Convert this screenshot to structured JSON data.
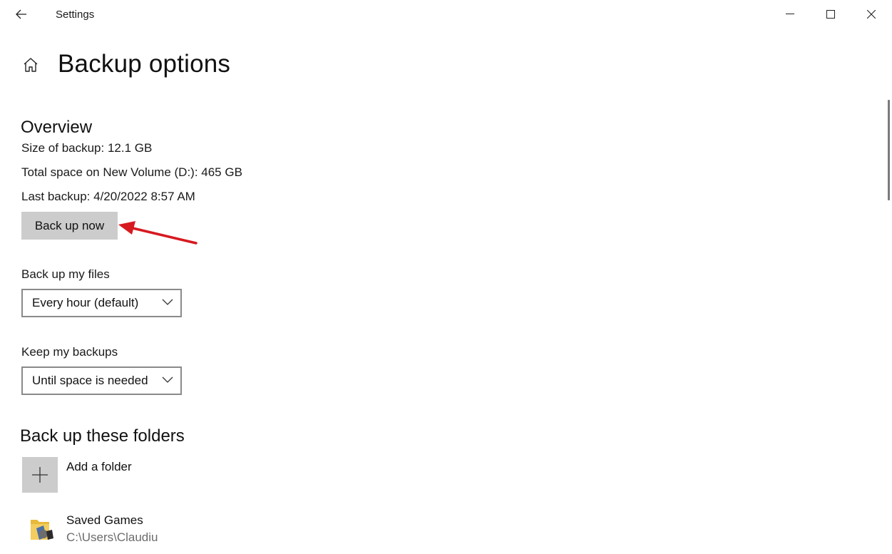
{
  "window": {
    "title": "Settings",
    "back_icon": "arrow-left-icon",
    "minimize_icon": "minimize-icon",
    "maximize_icon": "maximize-icon",
    "close_icon": "close-icon"
  },
  "page": {
    "home_icon": "home-icon",
    "title": "Backup options"
  },
  "overview": {
    "heading": "Overview",
    "size_of_backup": "Size of backup: 12.1 GB",
    "total_space": "Total space on New Volume (D:): 465 GB",
    "last_backup": "Last backup: 4/20/2022 8:57 AM",
    "back_up_now_label": "Back up now"
  },
  "schedule": {
    "backup_files_label": "Back up my files",
    "backup_files_value": "Every hour (default)",
    "keep_backups_label": "Keep my backups",
    "keep_backups_value": "Until space is needed"
  },
  "folders": {
    "heading": "Back up these folders",
    "add_folder_label": "Add a folder",
    "add_icon": "plus-icon",
    "items": [
      {
        "name": "Saved Games",
        "path": "C:\\Users\\Claudiu",
        "icon": "saved-games-folder-icon"
      }
    ]
  },
  "annotation": {
    "arrow_color": "#d71920"
  },
  "colors": {
    "button_bg": "#cccccc",
    "select_border": "#8a8a8a"
  }
}
